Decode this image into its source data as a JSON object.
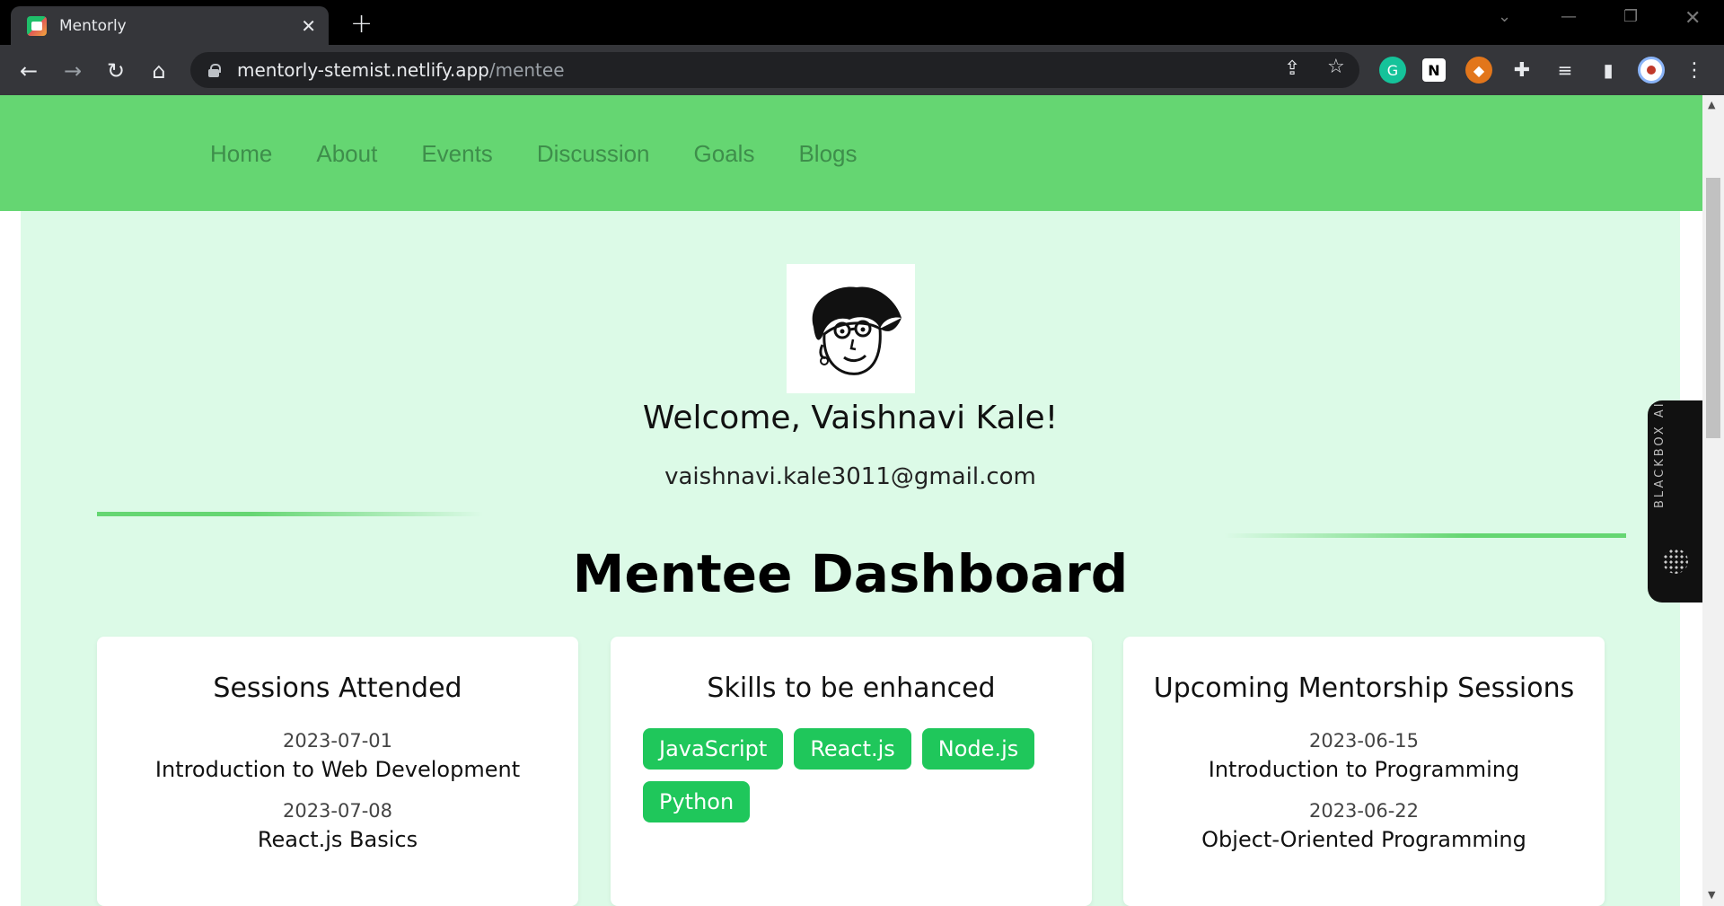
{
  "browser": {
    "tab_title": "Mentorly",
    "url_host": "mentorly-stemist.netlify.app",
    "url_path": "/mentee"
  },
  "nav": {
    "links": [
      "Home",
      "About",
      "Events",
      "Discussion",
      "Goals",
      "Blogs"
    ]
  },
  "profile": {
    "welcome": "Welcome, Vaishnavi Kale!",
    "email": "vaishnavi.kale3011@gmail.com"
  },
  "dashboard": {
    "title": "Mentee Dashboard",
    "sessions_attended": {
      "title": "Sessions Attended",
      "items": [
        {
          "date": "2023-07-01",
          "name": "Introduction to Web Development"
        },
        {
          "date": "2023-07-08",
          "name": "React.js Basics"
        }
      ]
    },
    "skills": {
      "title": "Skills to be enhanced",
      "items": [
        "JavaScript",
        "React.js",
        "Node.js",
        "Python"
      ]
    },
    "upcoming": {
      "title": "Upcoming Mentorship Sessions",
      "items": [
        {
          "date": "2023-06-15",
          "name": "Introduction to Programming"
        },
        {
          "date": "2023-06-22",
          "name": "Object-Oriented Programming"
        }
      ]
    }
  },
  "widget": {
    "label": "BLACKBOX AI"
  },
  "colors": {
    "nav_green": "#65d672",
    "content_bg": "#dcfae7",
    "skill_green": "#1fc75b"
  }
}
